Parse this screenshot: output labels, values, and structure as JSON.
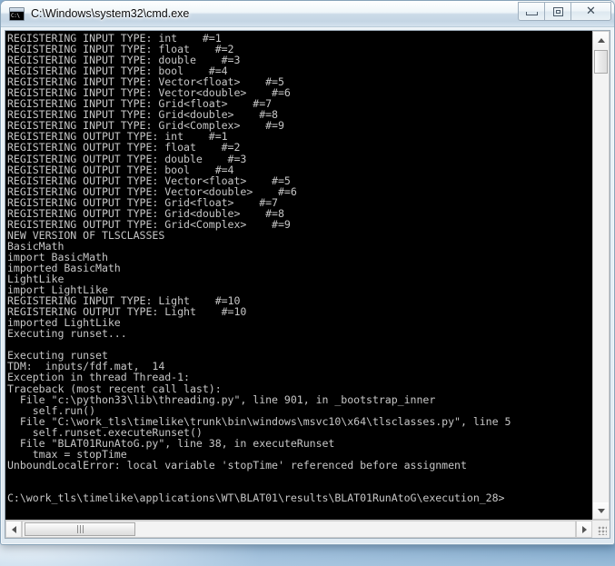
{
  "window": {
    "title": "C:\\Windows\\system32\\cmd.exe",
    "icon_name": "cmd-console-icon",
    "icon_text": "C:\\",
    "controls": {
      "minimize_label": "Minimize",
      "maximize_label": "Maximize",
      "close_label": "Close",
      "close_glyph": "✕"
    }
  },
  "console": {
    "foreground_color": "#c6c6c6",
    "background_color": "#000000",
    "lines": [
      "REGISTERING INPUT TYPE: int    #=1",
      "REGISTERING INPUT TYPE: float    #=2",
      "REGISTERING INPUT TYPE: double    #=3",
      "REGISTERING INPUT TYPE: bool    #=4",
      "REGISTERING INPUT TYPE: Vector<float>    #=5",
      "REGISTERING INPUT TYPE: Vector<double>    #=6",
      "REGISTERING INPUT TYPE: Grid<float>    #=7",
      "REGISTERING INPUT TYPE: Grid<double>    #=8",
      "REGISTERING INPUT TYPE: Grid<Complex>    #=9",
      "REGISTERING OUTPUT TYPE: int    #=1",
      "REGISTERING OUTPUT TYPE: float    #=2",
      "REGISTERING OUTPUT TYPE: double    #=3",
      "REGISTERING OUTPUT TYPE: bool    #=4",
      "REGISTERING OUTPUT TYPE: Vector<float>    #=5",
      "REGISTERING OUTPUT TYPE: Vector<double>    #=6",
      "REGISTERING OUTPUT TYPE: Grid<float>    #=7",
      "REGISTERING OUTPUT TYPE: Grid<double>    #=8",
      "REGISTERING OUTPUT TYPE: Grid<Complex>    #=9",
      "NEW VERSION OF TLSCLASSES",
      "BasicMath",
      "import BasicMath",
      "imported BasicMath",
      "LightLike",
      "import LightLike",
      "REGISTERING INPUT TYPE: Light    #=10",
      "REGISTERING OUTPUT TYPE: Light    #=10",
      "imported LightLike",
      "Executing runset...",
      "",
      "Executing runset",
      "TDM:  inputs/fdf.mat,  14",
      "Exception in thread Thread-1:",
      "Traceback (most recent call last):",
      "  File \"c:\\python33\\lib\\threading.py\", line 901, in _bootstrap_inner",
      "    self.run()",
      "  File \"C:\\work_tls\\timelike\\trunk\\bin\\windows\\msvc10\\x64\\tlsclasses.py\", line 5",
      "    self.runset.executeRunset()",
      "  File \"BLAT01RunAtoG.py\", line 38, in executeRunset",
      "    tmax = stopTime",
      "UnboundLocalError: local variable 'stopTime' referenced before assignment",
      "",
      "",
      "C:\\work_tls\\timelike\\applications\\WT\\BLAT01\\results\\BLAT01RunAtoG\\execution_28>"
    ]
  },
  "scrollbars": {
    "vertical": {
      "up_arrow_name": "scroll-up-arrow",
      "down_arrow_name": "scroll-down-arrow",
      "thumb_name": "vertical-scroll-thumb"
    },
    "horizontal": {
      "left_arrow_name": "scroll-left-arrow",
      "right_arrow_name": "scroll-right-arrow",
      "thumb_name": "horizontal-scroll-thumb"
    },
    "resize_grip_name": "window-resize-grip"
  }
}
